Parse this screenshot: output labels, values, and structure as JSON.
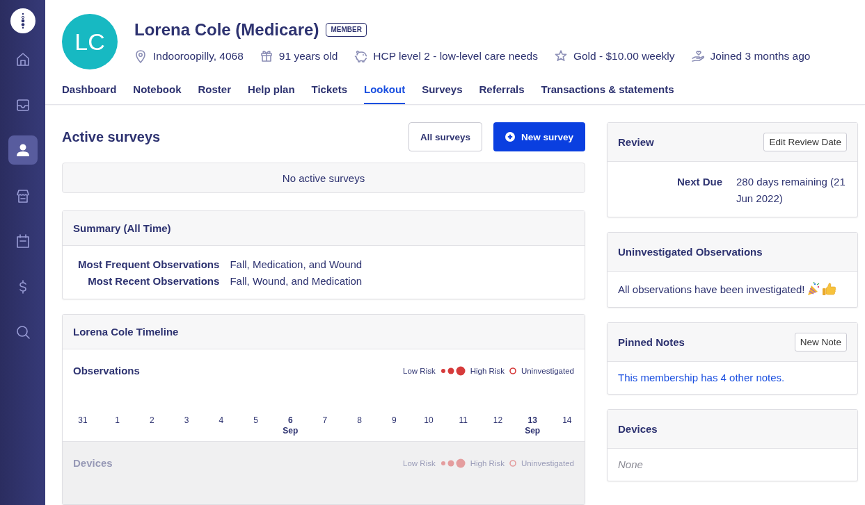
{
  "sidebar": {
    "items": [
      {
        "kind": "home",
        "selected": false
      },
      {
        "kind": "inbox",
        "selected": false
      },
      {
        "kind": "person",
        "selected": true
      },
      {
        "kind": "store",
        "selected": false
      },
      {
        "kind": "calendar",
        "selected": false
      },
      {
        "kind": "dollar",
        "selected": false
      },
      {
        "kind": "search",
        "selected": false
      }
    ]
  },
  "profile": {
    "initials": "LC",
    "name": "Lorena Cole (Medicare)",
    "badge": "MEMBER",
    "details": [
      {
        "kind": "location",
        "text": "Indooroopilly, 4068"
      },
      {
        "kind": "gift",
        "text": "91 years old"
      },
      {
        "kind": "piggy",
        "text": "HCP level 2 - low-level care needs"
      },
      {
        "kind": "star",
        "text": "Gold - $10.00 weekly"
      },
      {
        "kind": "hand",
        "text": "Joined 3 months ago"
      }
    ]
  },
  "tabs": [
    {
      "label": "Dashboard",
      "selected": false
    },
    {
      "label": "Notebook",
      "selected": false
    },
    {
      "label": "Roster",
      "selected": false
    },
    {
      "label": "Help plan",
      "selected": false
    },
    {
      "label": "Tickets",
      "selected": false
    },
    {
      "label": "Lookout",
      "selected": true
    },
    {
      "label": "Surveys",
      "selected": false
    },
    {
      "label": "Referrals",
      "selected": false
    },
    {
      "label": "Transactions & statements",
      "selected": false
    }
  ],
  "active_surveys": {
    "title": "Active surveys",
    "buttons": [
      {
        "label": "All surveys",
        "kind": "secondary"
      },
      {
        "label": "New survey",
        "kind": "primary"
      }
    ],
    "empty_message": "No active surveys"
  },
  "summary": {
    "title": "Summary (All Time)",
    "rows": [
      {
        "label": "Most Frequent Observations",
        "value": "Fall, Medication, and Wound"
      },
      {
        "label": "Most Recent Observations",
        "value": "Fall, Wound, and Medication"
      }
    ]
  },
  "timeline": {
    "title": "Lorena Cole Timeline",
    "sections": [
      {
        "title": "Observations",
        "disabled": false,
        "legend": {
          "low": "Low Risk",
          "high": "High Risk",
          "uninvestigated": "Uninvestigated"
        },
        "days": [
          {
            "day": "31"
          },
          {
            "day": "1"
          },
          {
            "day": "2"
          },
          {
            "day": "3"
          },
          {
            "day": "4"
          },
          {
            "day": "5"
          },
          {
            "day": "6",
            "month": "Sep"
          },
          {
            "day": "7"
          },
          {
            "day": "8"
          },
          {
            "day": "9"
          },
          {
            "day": "10"
          },
          {
            "day": "11"
          },
          {
            "day": "12"
          },
          {
            "day": "13",
            "month": "Sep"
          },
          {
            "day": "14"
          }
        ]
      },
      {
        "title": "Devices",
        "disabled": true,
        "legend": {
          "low": "Low Risk",
          "high": "High Risk",
          "uninvestigated": "Uninvestigated"
        }
      }
    ]
  },
  "review": {
    "title": "Review",
    "button": "Edit Review Date",
    "rows": [
      {
        "label": "Next Due",
        "value": "280 days remaining (21 Jun 2022)"
      }
    ]
  },
  "uninvestigated": {
    "title": "Uninvestigated Observations",
    "message": "All observations have been investigated!"
  },
  "pinned_notes": {
    "title": "Pinned Notes",
    "button": "New Note",
    "link": "This membership has 4 other notes."
  },
  "devices": {
    "title": "Devices",
    "empty": "None"
  }
}
